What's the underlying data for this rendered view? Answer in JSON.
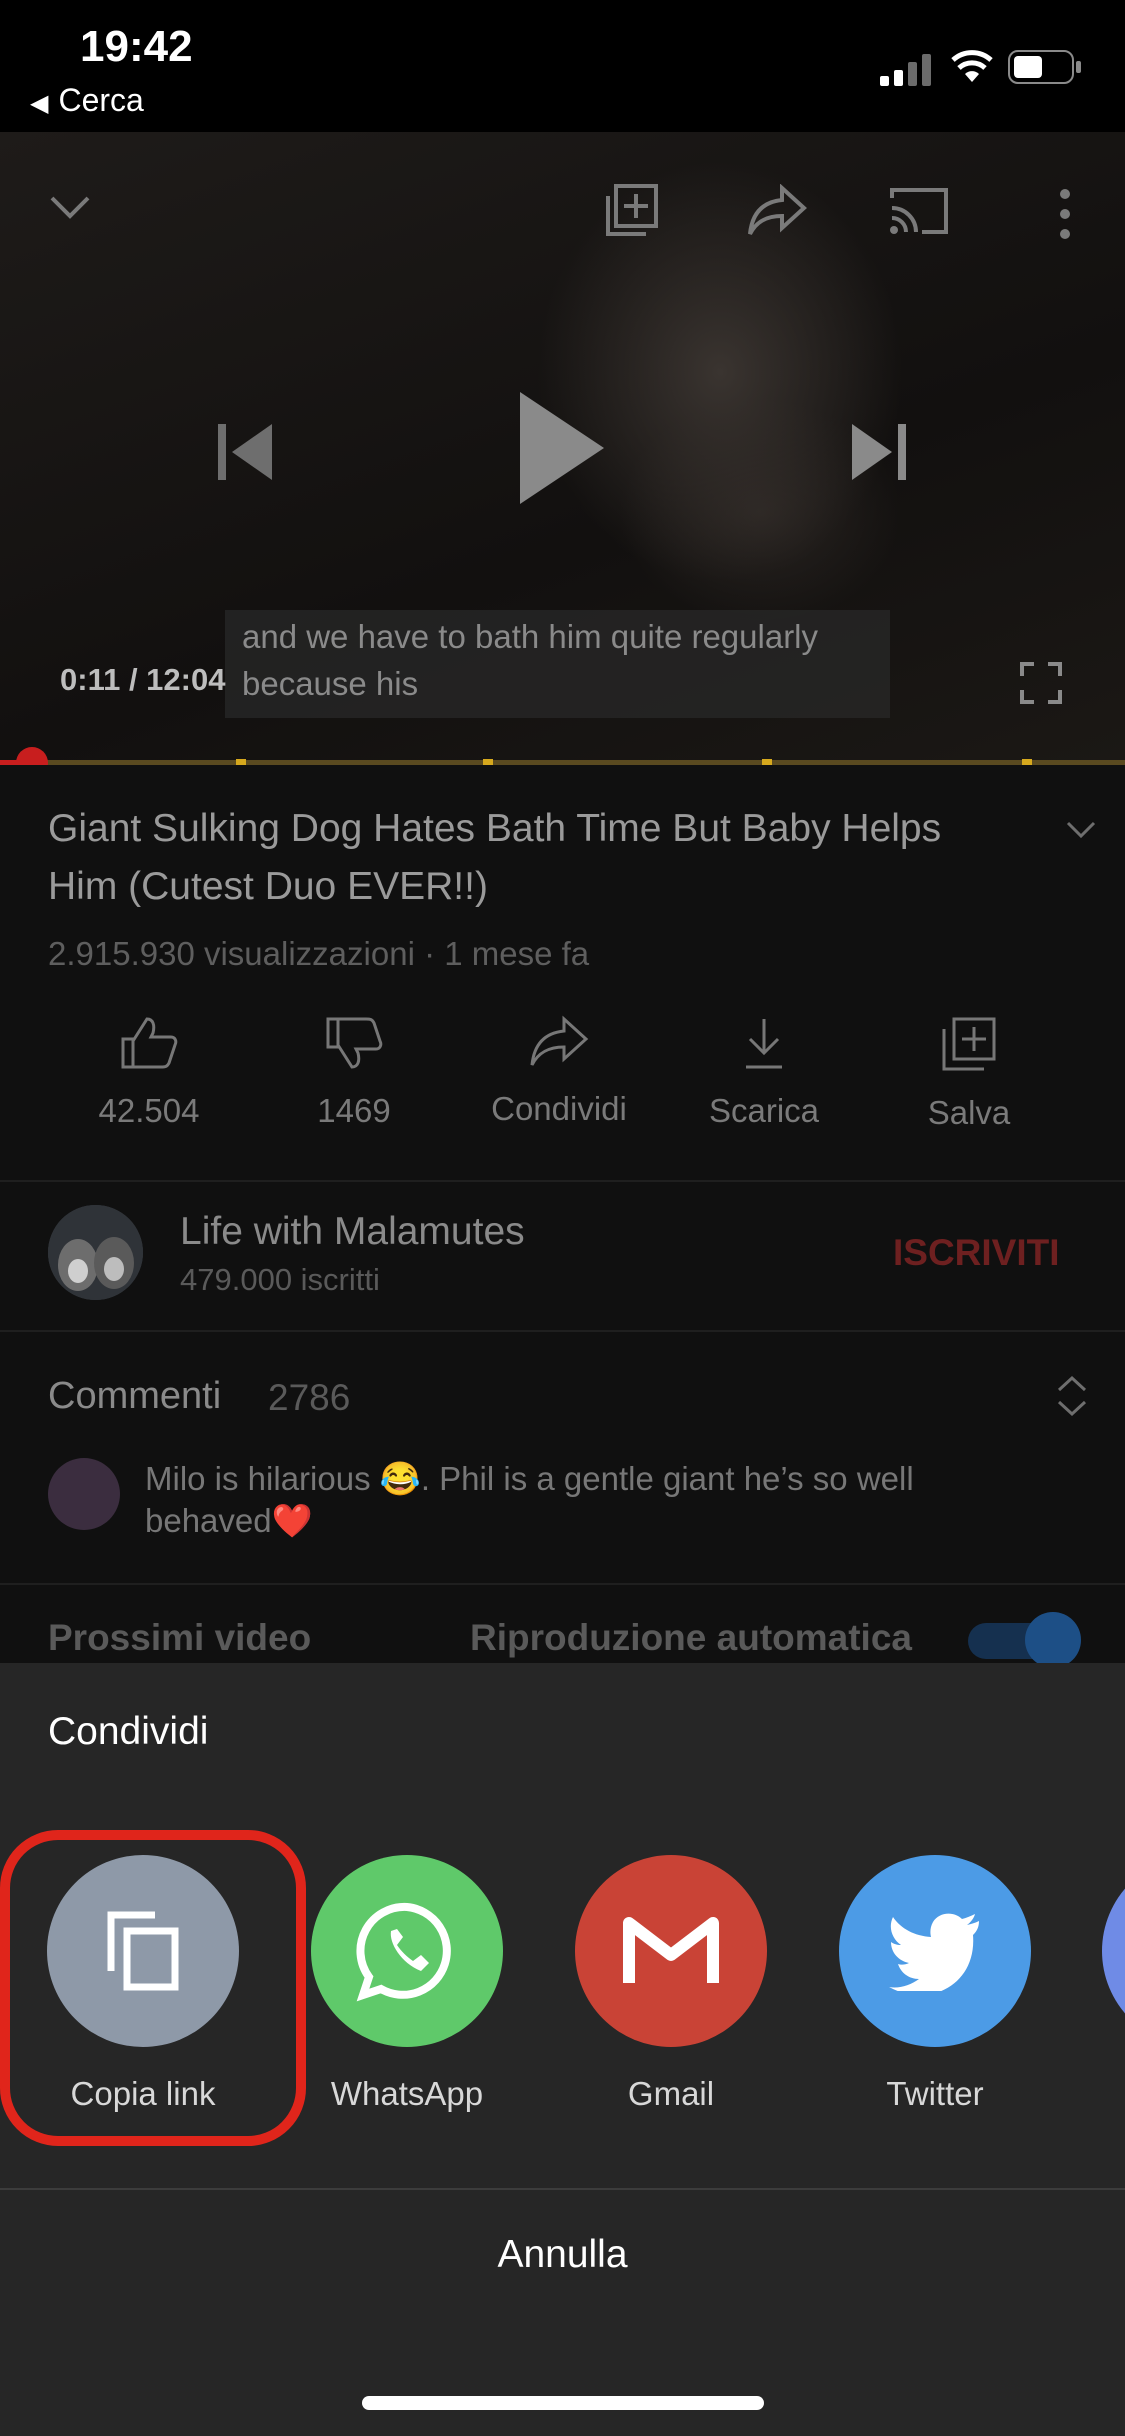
{
  "status_bar": {
    "time": "19:42",
    "back_app_label": "Cerca"
  },
  "player": {
    "captions": [
      "and we have to bath him quite regularly",
      "because his"
    ],
    "current_time": "0:11",
    "duration": "12:04",
    "timecode": "0:11 / 12:04",
    "progress": 0.015,
    "top_icons": [
      "collapse-chevron-icon",
      "add-to-playlist-icon",
      "share-icon",
      "cast-icon",
      "more-icon"
    ],
    "controls": [
      "previous-icon",
      "play-icon",
      "next-icon",
      "fullscreen-icon"
    ]
  },
  "video": {
    "title": "Giant Sulking Dog Hates Bath Time But Baby Helps Him (Cutest Duo EVER!!)",
    "meta": "2.915.930 visualizzazioni · 1 mese fa",
    "actions": [
      {
        "label": "42.504",
        "icon": "thumbs-up-icon"
      },
      {
        "label": "1469",
        "icon": "thumbs-down-icon"
      },
      {
        "label": "Condividi",
        "icon": "share-icon"
      },
      {
        "label": "Scarica",
        "icon": "download-icon"
      },
      {
        "label": "Salva",
        "icon": "add-to-playlist-icon"
      }
    ]
  },
  "channel": {
    "name": "Life with Malamutes",
    "subscribers": "479.000 iscritti",
    "subscribe_label": "ISCRIVITI"
  },
  "comments": {
    "title": "Commenti",
    "count": "2786",
    "top_comment": "Milo is hilarious 😂. Phil is a gentle giant he’s so well behaved❤️"
  },
  "up_next": {
    "label": "Prossimi video",
    "autoplay_label": "Riproduzione automatica",
    "autoplay_on": true
  },
  "share_sheet": {
    "title": "Condividi",
    "targets": [
      {
        "label": "Copia link",
        "color": "#8e99a8",
        "icon": "copy-link-icon"
      },
      {
        "label": "WhatsApp",
        "color": "#5fc96a",
        "icon": "whatsapp-icon"
      },
      {
        "label": "Gmail",
        "color": "#c94336",
        "icon": "gmail-icon"
      },
      {
        "label": "Twitter",
        "color": "#4c9be6",
        "icon": "twitter-icon"
      }
    ],
    "cancel_label": "Annulla",
    "highlight_color": "#e0251b"
  }
}
